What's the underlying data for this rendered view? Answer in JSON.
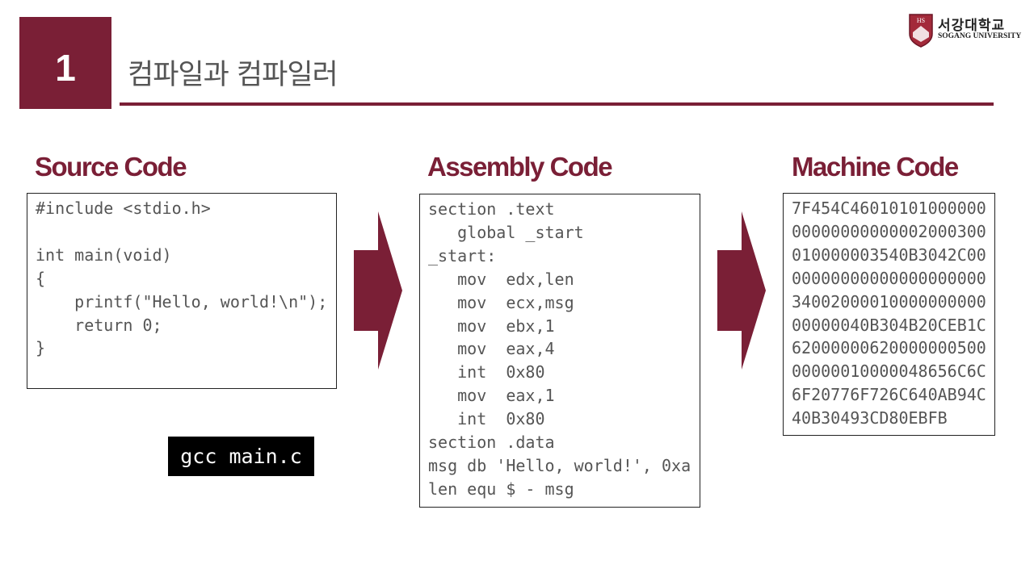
{
  "slide": {
    "number": "1",
    "title": "컴파일과 컴파일러"
  },
  "logo": {
    "badge": "HS",
    "name_kr": "서강대학교",
    "name_en": "SOGANG UNIVERSITY"
  },
  "columns": {
    "source": {
      "heading": "Source Code",
      "code": "#include <stdio.h>\n\nint main(void)\n{\n    printf(\"Hello, world!\\n\");\n    return 0;\n}"
    },
    "assembly": {
      "heading": "Assembly Code",
      "code": "section .text\n   global _start\n_start:\n   mov  edx,len\n   mov  ecx,msg\n   mov  ebx,1\n   mov  eax,4\n   int  0x80\n   mov  eax,1\n   int  0x80\nsection .data\nmsg db 'Hello, world!', 0xa\nlen equ $ - msg"
    },
    "machine": {
      "heading": "Machine Code",
      "code": "7F454C46010101000000\n00000000000002000300\n010000003540B3042C00\n00000000000000000000\n34002000010000000000\n00000040B304B20CEB1C\n62000000620000000500\n00000010000048656C6C\n6F20776F726C640AB94C\n40B30493CD80EBFB"
    }
  },
  "command": {
    "label": "gcc main.c"
  },
  "colors": {
    "accent": "#7a1f36",
    "text_gray": "#555555",
    "command_bg": "#000000"
  }
}
